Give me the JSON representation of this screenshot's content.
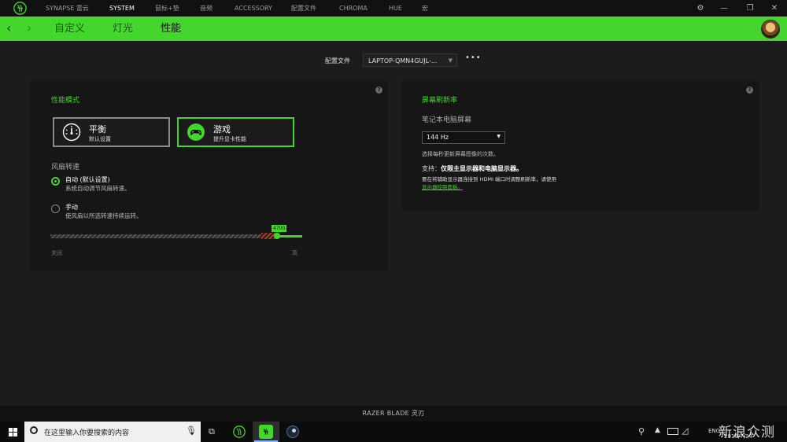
{
  "topnav": {
    "items": [
      "SYNAPSE 雷云",
      "SYSTEM",
      "鼠标+垫",
      "音频",
      "ACCESSORY",
      "配置文件",
      "CHROMA",
      "HUE",
      "宏"
    ],
    "active_index": 1
  },
  "subnav": {
    "tabs": [
      "自定义",
      "灯光",
      "性能"
    ],
    "active_index": 2
  },
  "profile": {
    "label": "配置文件",
    "value": "LAPTOP-QMN4GUJL-...",
    "more": "•••"
  },
  "performance": {
    "title": "性能模式",
    "modes": [
      {
        "title": "平衡",
        "subtitle": "默认设置",
        "icon": "gauge-icon"
      },
      {
        "title": "游戏",
        "subtitle": "提升显卡性能",
        "icon": "gamepad-icon"
      }
    ],
    "active_mode": 1,
    "fan_label": "风扇转速",
    "fan_options": [
      {
        "title": "自动 (默认设置)",
        "subtitle": "系统自动调节风扇转速。",
        "selected": true
      },
      {
        "title": "手动",
        "subtitle": "使风扇以所选转速持续运转。",
        "selected": false
      }
    ],
    "slider": {
      "tooltip": "4700",
      "min_label": "关闭",
      "max_label": "高"
    }
  },
  "refresh": {
    "title": "屏幕刷新率",
    "screen_label": "笔记本电脑屏幕",
    "value": "144 Hz",
    "desc": "选择每秒更新屏幕图像的次数。",
    "support_prefix": "支持：",
    "support_bold": "仅限主显示器和电脑显示器。",
    "note": "要在将辅助显示器连接到 HDMI 端口时调整刷新率，请使用",
    "link": "显示器控制面板。"
  },
  "device": {
    "name": "RAZER BLADE 灵刃"
  },
  "taskbar": {
    "search_placeholder": "在这里输入你要搜索的内容",
    "tray_lang": "ENG",
    "date": "2018/7/24",
    "watermark": "新浪众测"
  },
  "colors": {
    "accent": "#44d62c",
    "background": "#1c1c1c",
    "panel": "#161616"
  }
}
